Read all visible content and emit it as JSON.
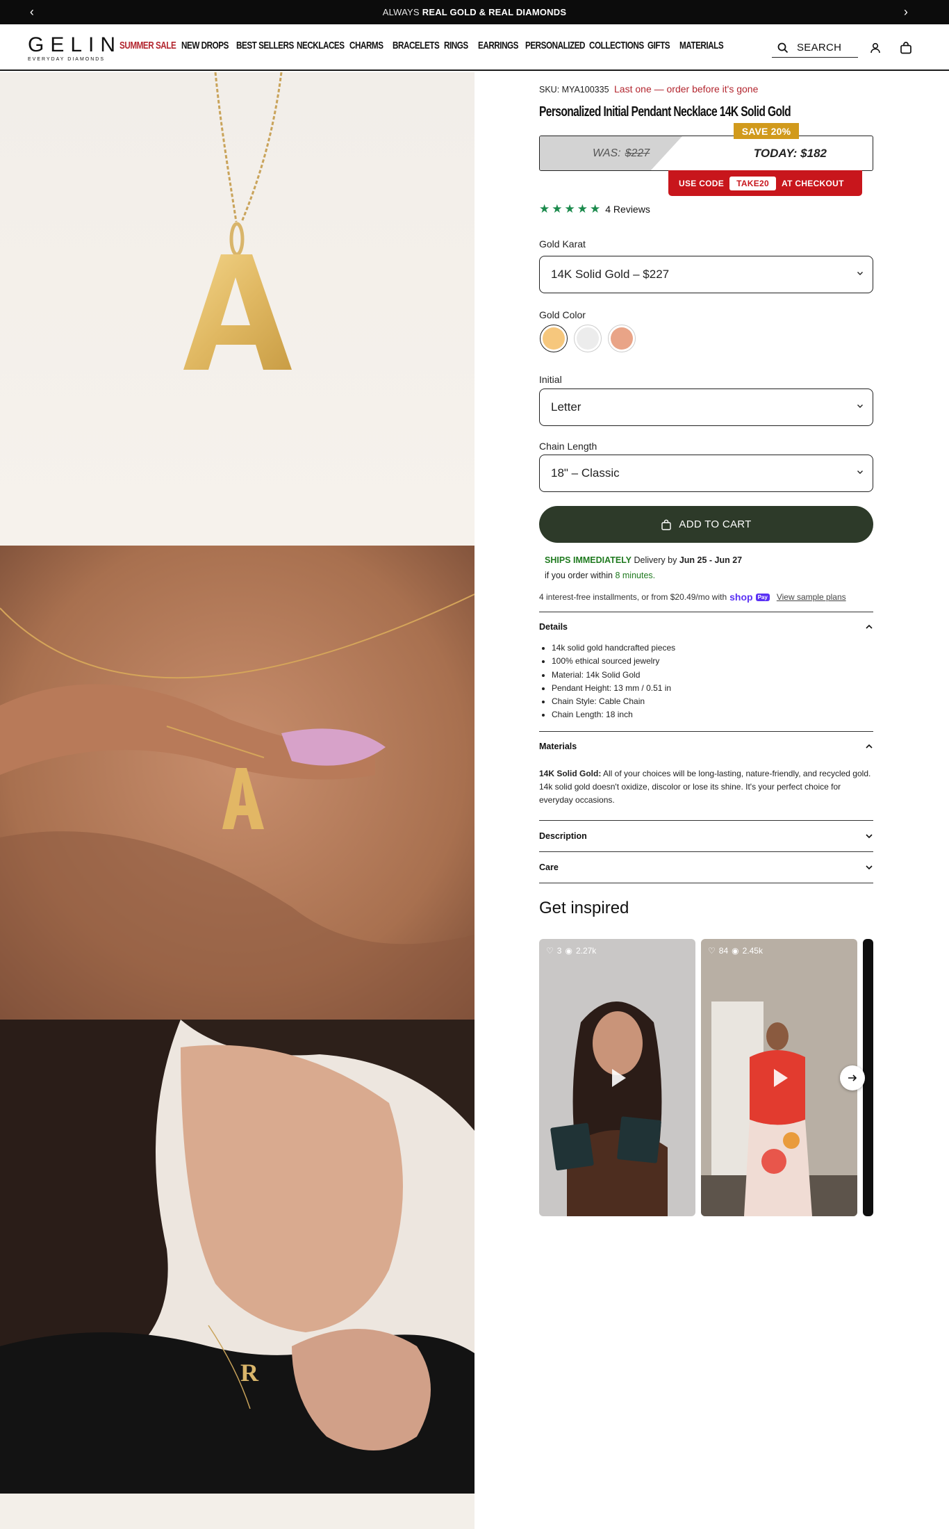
{
  "announcement": {
    "prefix": "ALWAYS",
    "bold": "REAL GOLD & REAL DIAMONDS"
  },
  "brand": {
    "name": "GELIN",
    "tagline": "EVERYDAY DIAMONDS"
  },
  "nav": {
    "items": [
      "SUMMER SALE",
      "NEW DROPS",
      "BEST SELLERS",
      "NECKLACES",
      "CHARMS",
      "BRACELETS",
      "RINGS",
      "EARRINGS",
      "PERSONALIZED",
      "COLLECTIONS",
      "GIFTS",
      "MATERIALS"
    ],
    "highlight_color": "#b3262f"
  },
  "search": {
    "label": "SEARCH"
  },
  "product": {
    "sku": "SKU: MYA100335",
    "stock_note": "Last one — order before it's gone",
    "title": "Personalized Initial Pendant Necklace 14K Solid Gold",
    "save_badge": "SAVE 20%",
    "was_label": "WAS:",
    "was_price": "$227",
    "today": "TODAY: $182",
    "code": {
      "prefix": "USE CODE",
      "code": "TAKE20",
      "suffix": "AT CHECKOUT"
    },
    "rating": 5,
    "reviews": "4 Reviews"
  },
  "options": {
    "karat": {
      "label": "Gold Karat",
      "value": "14K Solid Gold – $227"
    },
    "color": {
      "label": "Gold Color",
      "swatches": [
        "#f6c77d",
        "#ececec",
        "#e9a487"
      ],
      "selected_index": 0
    },
    "initial": {
      "label": "Initial",
      "value": "Letter"
    },
    "chain": {
      "label": "Chain Length",
      "value": "18\" – Classic"
    }
  },
  "cart": {
    "label": "ADD TO CART"
  },
  "shipping": {
    "ships": "SHIPS IMMEDIATELY",
    "delivery": "Delivery by",
    "dates": "Jun 25 - Jun 27",
    "order_prefix": "if you order within",
    "minutes": "8 minutes."
  },
  "installments": {
    "text": "4 interest-free installments, or from $20.49/mo with",
    "shop": "shop",
    "pay": "Pay",
    "link": "View sample plans"
  },
  "details": {
    "title": "Details",
    "items": [
      "14k solid gold handcrafted pieces",
      "100% ethical sourced jewelry",
      "Material: 14k Solid Gold",
      "Pendant Height: 13 mm / 0.51 in",
      "Chain Style: Cable Chain",
      "Chain Length: 18 inch"
    ]
  },
  "materials": {
    "title": "Materials",
    "bold": "14K Solid Gold:",
    "text": "All of your choices will be long-lasting, nature-friendly, and recycled gold. 14k solid gold doesn't oxidize, discolor or lose its shine. It's your perfect choice for everyday occasions."
  },
  "description": {
    "title": "Description"
  },
  "care": {
    "title": "Care"
  },
  "inspired": {
    "title": "Get inspired",
    "videos": [
      {
        "likes": "3",
        "views": "2.27k"
      },
      {
        "likes": "84",
        "views": "2.45k"
      }
    ]
  }
}
